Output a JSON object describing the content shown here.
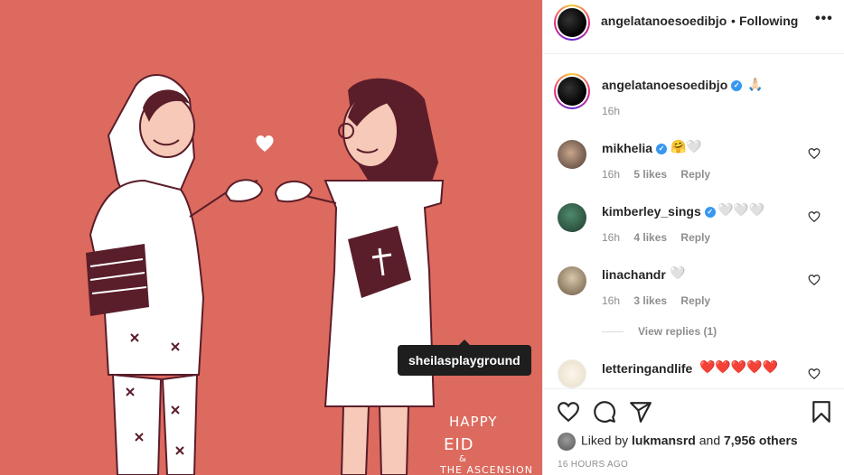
{
  "post": {
    "tag_username": "sheilasplayground",
    "art_text_line1": "HAPPY",
    "art_text_line2": "EID",
    "art_text_line3": "&",
    "art_text_line4": "THE ASCENSION"
  },
  "header": {
    "username": "angelatanoesoedibjo",
    "separator": "•",
    "follow_status": "Following",
    "more_label": "•••"
  },
  "caption": {
    "username": "angelatanoesoedibjo",
    "text": "🙏🏻",
    "time": "16h"
  },
  "comments": [
    {
      "username": "mikhelia",
      "verified": true,
      "text": "🤗🤍",
      "time": "16h",
      "likes": "5 likes",
      "reply": "Reply"
    },
    {
      "username": "kimberley_sings",
      "verified": true,
      "text": "🤍🤍🤍",
      "time": "16h",
      "likes": "4 likes",
      "reply": "Reply"
    },
    {
      "username": "linachandr",
      "verified": false,
      "text": "🤍",
      "time": "16h",
      "likes": "3 likes",
      "reply": "Reply",
      "view_replies": "View replies (1)"
    },
    {
      "username": "letteringandlife",
      "verified": false,
      "text": "❤️❤️❤️❤️❤️",
      "time": "",
      "likes": "",
      "reply": ""
    }
  ],
  "likes": {
    "prefix": "Liked by",
    "by_user": "lukmansrd",
    "and": "and",
    "others": "7,956 others"
  },
  "timestamp": "16 HOURS AGO",
  "colors": {
    "background_art": "#dd6a5e",
    "verified": "#3897f0",
    "text_primary": "#262626",
    "text_secondary": "#8e8e8e"
  },
  "icons": [
    "heart-icon",
    "comment-icon",
    "share-icon",
    "bookmark-icon",
    "more-icon",
    "verified-icon"
  ]
}
